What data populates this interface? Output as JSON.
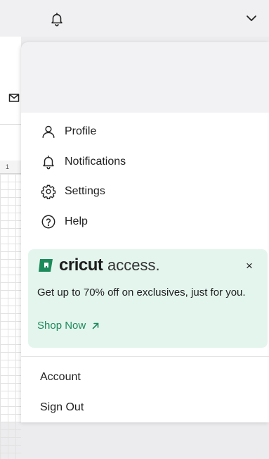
{
  "header": {
    "icons": [
      "bell-icon",
      "chevron-down-icon"
    ]
  },
  "background": {
    "ruler_number": "1"
  },
  "menu": {
    "items": [
      {
        "label": "Profile",
        "icon": "user-icon"
      },
      {
        "label": "Notifications",
        "icon": "bell-icon"
      },
      {
        "label": "Settings",
        "icon": "gear-icon"
      },
      {
        "label": "Help",
        "icon": "help-circle-icon"
      }
    ]
  },
  "promo": {
    "brand": "cricut",
    "brand_suffix": "access",
    "brand_dot": ".",
    "description": "Get up to 70% off on exclusives, just for you.",
    "cta_label": "Shop Now",
    "close_label": "×",
    "accent_color": "#1c8a5a",
    "background_color": "#e4f5ee"
  },
  "account": {
    "items": [
      {
        "label": "Account"
      },
      {
        "label": "Sign Out"
      }
    ]
  }
}
